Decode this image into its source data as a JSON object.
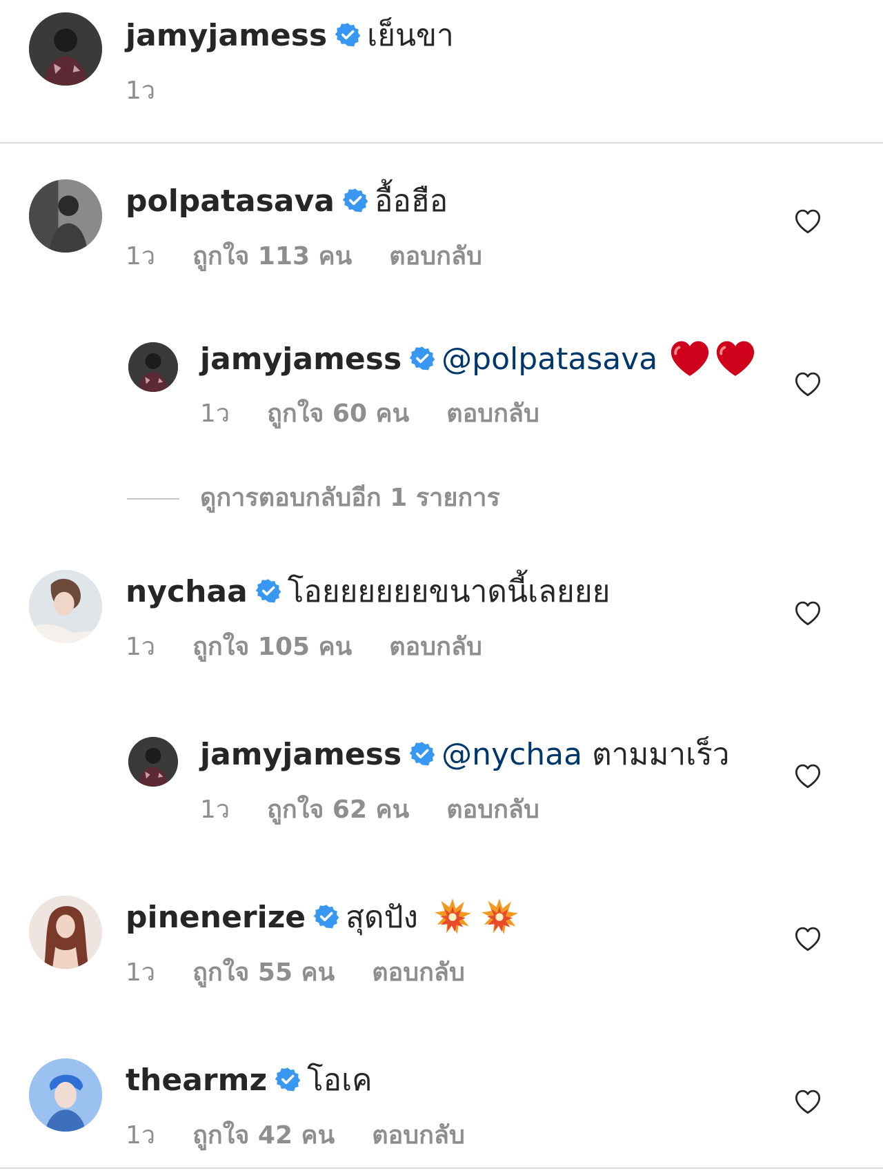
{
  "caption": {
    "username": "jamyjamess",
    "text": "เย็นขา",
    "time": "1ว"
  },
  "comments": [
    {
      "username": "polpatasava",
      "text": "อื้อฮือ",
      "time": "1ว",
      "likes": "ถูกใจ 113 คน",
      "reply_label": "ตอบกลับ"
    },
    {
      "username": "jamyjamess",
      "mention": "@polpatasava",
      "text": "",
      "emoji": "heart-emoji x2",
      "time": "1ว",
      "likes": "ถูกใจ 60 คน",
      "reply_label": "ตอบกลับ"
    },
    {
      "username": "nychaa",
      "text": "โอยยยยยยขนาดนี้เลยยย",
      "time": "1ว",
      "likes": "ถูกใจ 105 คน",
      "reply_label": "ตอบกลับ"
    },
    {
      "username": "jamyjamess",
      "mention": "@nychaa",
      "text": "ตามมาเร็ว",
      "time": "1ว",
      "likes": "ถูกใจ 62 คน",
      "reply_label": "ตอบกลับ"
    },
    {
      "username": "pinenerize",
      "text": "สุดปัง",
      "emoji": "collision-emoji x2",
      "time": "1ว",
      "likes": "ถูกใจ 55 คน",
      "reply_label": "ตอบกลับ"
    },
    {
      "username": "thearmz",
      "text": "โอเค",
      "time": "1ว",
      "likes": "ถูกใจ 42 คน",
      "reply_label": "ตอบกลับ"
    }
  ],
  "view_more_replies": "ดูการตอบกลับอีก 1 รายการ",
  "colors": {
    "verified": "#3897f0",
    "mention": "#00376b",
    "meta": "#8e8e8e",
    "divider": "#dbdbdb"
  },
  "icons": {
    "verified": "verified-badge-icon",
    "like": "heart-outline-icon"
  }
}
